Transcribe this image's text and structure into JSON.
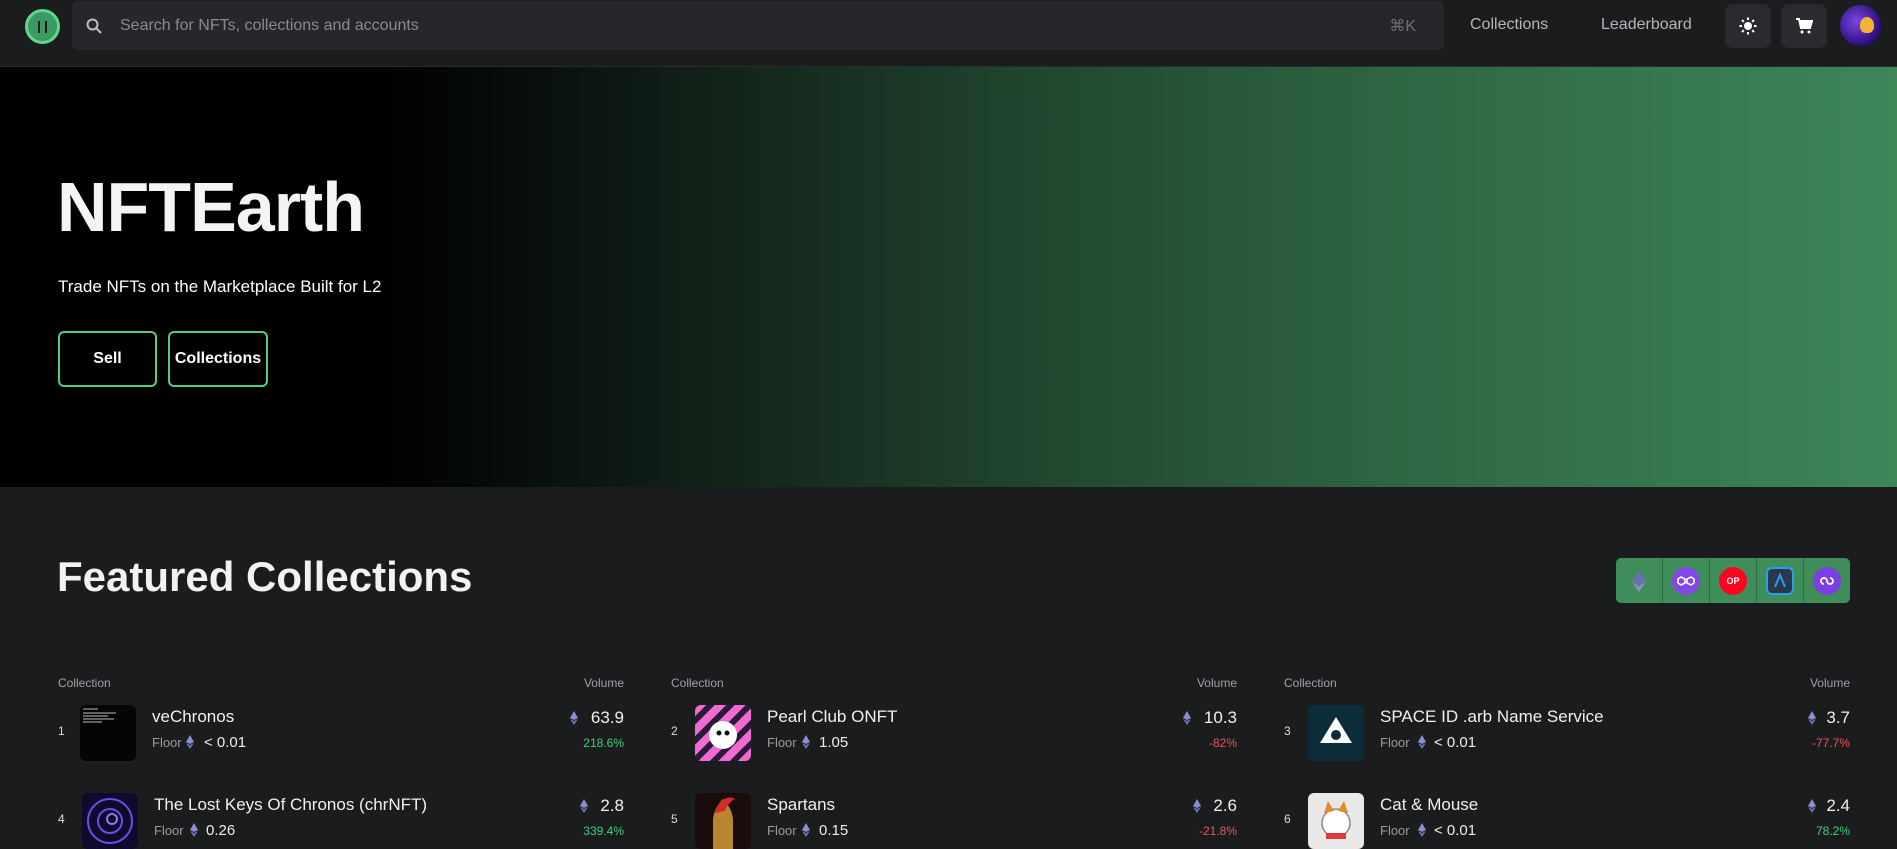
{
  "nav": {
    "search_placeholder": "Search for NFTs, collections and accounts",
    "shortcut": "⌘K",
    "links": [
      "Collections",
      "Leaderboard"
    ]
  },
  "hero": {
    "title": "NFTEarth",
    "subtitle": "Trade NFTs on the Marketplace Built for L2",
    "buttons": [
      "Sell",
      "Collections"
    ]
  },
  "featured": {
    "title": "Featured Collections",
    "chains": [
      "ethereum-icon",
      "polygon-icon",
      "optimism-icon",
      "arbitrum-icon",
      "polygon-zkevm-icon"
    ],
    "chain_chip_label": "OP",
    "column_header": "Collection",
    "volume_header": "Volume",
    "floor_label": "Floor",
    "rows": [
      {
        "rank": "1",
        "name": "veChronos",
        "floor": "< 0.01",
        "volume": "63.9",
        "change": "218.6%",
        "trend": "up"
      },
      {
        "rank": "2",
        "name": "Pearl Club ONFT",
        "floor": "1.05",
        "volume": "10.3",
        "change": "-82%",
        "trend": "down"
      },
      {
        "rank": "3",
        "name": "SPACE ID .arb Name Service",
        "floor": "< 0.01",
        "volume": "3.7",
        "change": "-77.7%",
        "trend": "down"
      },
      {
        "rank": "4",
        "name": "The Lost Keys Of Chronos (chrNFT)",
        "floor": "0.26",
        "volume": "2.8",
        "change": "339.4%",
        "trend": "up"
      },
      {
        "rank": "5",
        "name": "Spartans",
        "floor": "0.15",
        "volume": "2.6",
        "change": "-21.8%",
        "trend": "down"
      },
      {
        "rank": "6",
        "name": "Cat & Mouse",
        "floor": "< 0.01",
        "volume": "2.4",
        "change": "78.2%",
        "trend": "up"
      }
    ]
  },
  "colors": {
    "accent_green": "#4fd07e",
    "positive": "#3fcf7d",
    "negative": "#f0505a"
  }
}
